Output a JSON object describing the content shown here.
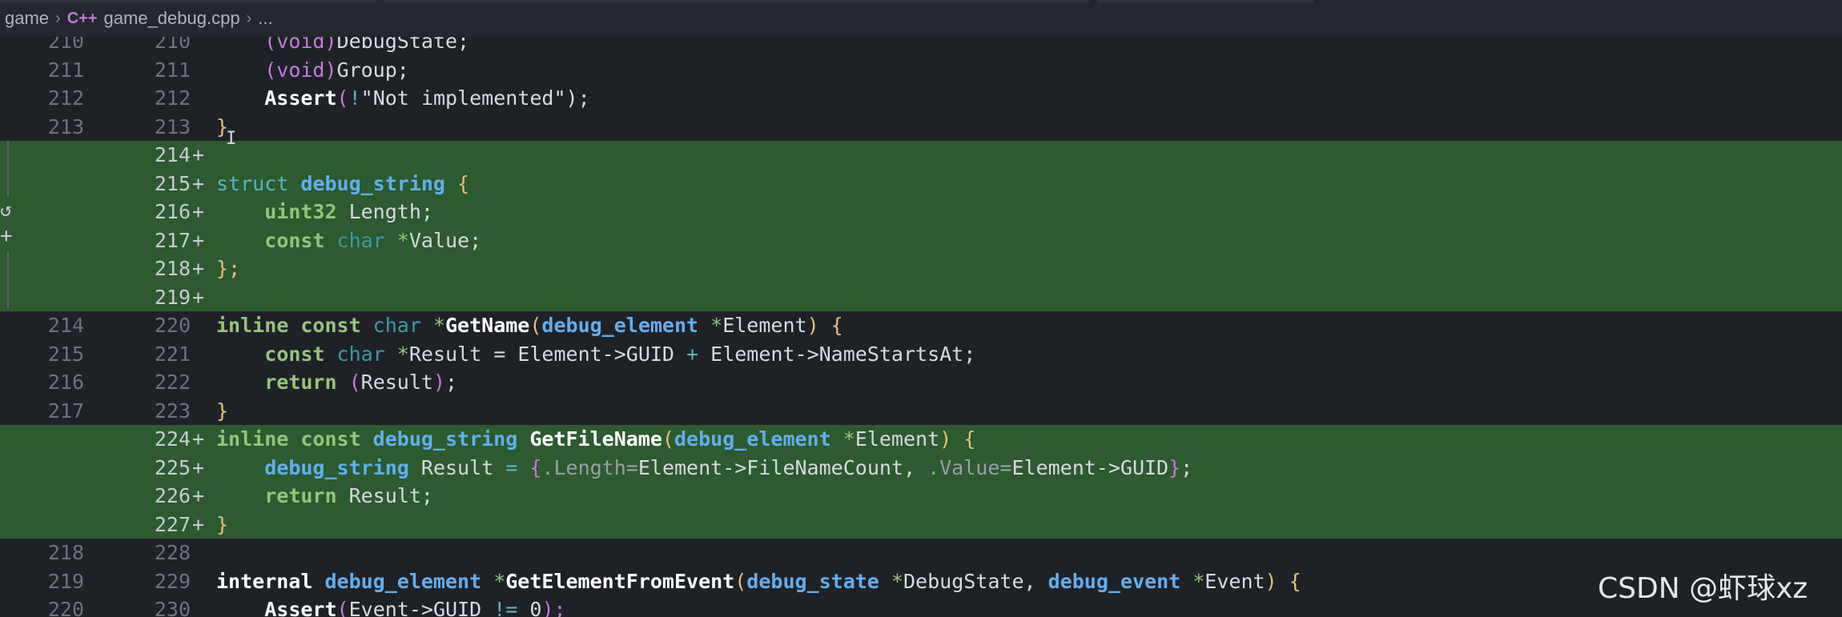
{
  "breadcrumb": {
    "folder": "game",
    "lang_icon": "C++",
    "file": "game_debug.cpp",
    "ellipsis": "..."
  },
  "watermark": "CSDN @虾球xz",
  "lines": [
    {
      "old": "210",
      "new": "210",
      "added": false,
      "tokens": [
        [
          "    ",
          "st"
        ],
        [
          "(void)",
          "pp"
        ],
        [
          "DebugState;",
          "st"
        ]
      ]
    },
    {
      "old": "211",
      "new": "211",
      "added": false,
      "tokens": [
        [
          "    ",
          "st"
        ],
        [
          "(void)",
          "pp"
        ],
        [
          "Group;",
          "st"
        ]
      ]
    },
    {
      "old": "212",
      "new": "212",
      "added": false,
      "tokens": [
        [
          "    ",
          "st"
        ],
        [
          "Assert",
          "fn"
        ],
        [
          "(",
          "pp"
        ],
        [
          "!",
          "op"
        ],
        [
          "\"Not implemented\"",
          "st"
        ],
        [
          ");",
          "st"
        ]
      ]
    },
    {
      "old": "213",
      "new": "213",
      "added": false,
      "tokens": [
        [
          "}",
          "pr"
        ]
      ]
    },
    {
      "old": "",
      "new": "214",
      "added": true,
      "tokens": []
    },
    {
      "old": "",
      "new": "215",
      "added": true,
      "tokens": [
        [
          "struct ",
          "kw"
        ],
        [
          "debug_string ",
          "ty"
        ],
        [
          "{",
          "pr"
        ]
      ]
    },
    {
      "old": "",
      "new": "216",
      "added": true,
      "tokens": [
        [
          "    ",
          "st"
        ],
        [
          "uint32 ",
          "kwb"
        ],
        [
          "Length;",
          "st"
        ]
      ]
    },
    {
      "old": "",
      "new": "217",
      "added": true,
      "tokens": [
        [
          "    ",
          "st"
        ],
        [
          "const ",
          "kwb"
        ],
        [
          "char ",
          "tyd"
        ],
        [
          "*",
          "ptr"
        ],
        [
          "Value;",
          "st"
        ]
      ]
    },
    {
      "old": "",
      "new": "218",
      "added": true,
      "tokens": [
        [
          "};",
          "pr"
        ]
      ]
    },
    {
      "old": "",
      "new": "219",
      "added": true,
      "tokens": []
    },
    {
      "old": "214",
      "new": "220",
      "added": false,
      "tokens": [
        [
          "inline ",
          "kwb"
        ],
        [
          "const ",
          "kwb"
        ],
        [
          "char ",
          "tyd"
        ],
        [
          "*",
          "ptr"
        ],
        [
          "GetName",
          "fn"
        ],
        [
          "(",
          "pr"
        ],
        [
          "debug_element ",
          "ty"
        ],
        [
          "*",
          "ptr"
        ],
        [
          "Element",
          "st"
        ],
        [
          ") {",
          "pr"
        ]
      ]
    },
    {
      "old": "215",
      "new": "221",
      "added": false,
      "tokens": [
        [
          "    ",
          "st"
        ],
        [
          "const ",
          "kwb"
        ],
        [
          "char ",
          "tyd"
        ],
        [
          "*",
          "ptr"
        ],
        [
          "Result = Element->GUID ",
          "st"
        ],
        [
          "+ ",
          "op"
        ],
        [
          "Element->NameStartsAt;",
          "st"
        ]
      ]
    },
    {
      "old": "216",
      "new": "222",
      "added": false,
      "tokens": [
        [
          "    ",
          "st"
        ],
        [
          "return ",
          "kwb"
        ],
        [
          "(",
          "pp"
        ],
        [
          "Result",
          "st"
        ],
        [
          ")",
          "pp"
        ],
        [
          ";",
          "st"
        ]
      ]
    },
    {
      "old": "217",
      "new": "223",
      "added": false,
      "tokens": [
        [
          "}",
          "pr"
        ]
      ]
    },
    {
      "old": "",
      "new": "224",
      "added": true,
      "tokens": [
        [
          "inline ",
          "kwb"
        ],
        [
          "const ",
          "kwb"
        ],
        [
          "debug_string ",
          "ty"
        ],
        [
          "GetFileName",
          "fn"
        ],
        [
          "(",
          "pr"
        ],
        [
          "debug_element ",
          "ty"
        ],
        [
          "*",
          "ptr"
        ],
        [
          "Element",
          "st"
        ],
        [
          ") {",
          "pr"
        ]
      ]
    },
    {
      "old": "",
      "new": "225",
      "added": true,
      "tokens": [
        [
          "    ",
          "st"
        ],
        [
          "debug_string ",
          "ty"
        ],
        [
          "Result ",
          "st"
        ],
        [
          "= ",
          "op"
        ],
        [
          "{",
          "pp"
        ],
        [
          ".Length=",
          "fld"
        ],
        [
          "Element->FileNameCount, ",
          "st"
        ],
        [
          ".Value=",
          "fld"
        ],
        [
          "Element->GUID",
          "st"
        ],
        [
          "}",
          "pp"
        ],
        [
          ";",
          "st"
        ]
      ]
    },
    {
      "old": "",
      "new": "226",
      "added": true,
      "tokens": [
        [
          "    ",
          "st"
        ],
        [
          "return ",
          "kwb"
        ],
        [
          "Result;",
          "st"
        ]
      ]
    },
    {
      "old": "",
      "new": "227",
      "added": true,
      "tokens": [
        [
          "}",
          "pr"
        ]
      ]
    },
    {
      "old": "218",
      "new": "228",
      "added": false,
      "tokens": []
    },
    {
      "old": "219",
      "new": "229",
      "added": false,
      "tokens": [
        [
          "internal ",
          "fn"
        ],
        [
          "debug_element ",
          "ty"
        ],
        [
          "*",
          "ptr"
        ],
        [
          "GetElementFromEvent",
          "fn"
        ],
        [
          "(",
          "pr"
        ],
        [
          "debug_state ",
          "ty"
        ],
        [
          "*",
          "ptr"
        ],
        [
          "DebugState, ",
          "st"
        ],
        [
          "debug_event ",
          "ty"
        ],
        [
          "*",
          "ptr"
        ],
        [
          "Event",
          "st"
        ],
        [
          ") {",
          "pr"
        ]
      ]
    },
    {
      "old": "220",
      "new": "230",
      "added": false,
      "tokens": [
        [
          "    ",
          "st"
        ],
        [
          "Assert",
          "fn"
        ],
        [
          "(",
          "pp"
        ],
        [
          "Event->GUID ",
          "st"
        ],
        [
          "!= ",
          "op"
        ],
        [
          "0",
          "st"
        ],
        [
          ");",
          "pp"
        ]
      ]
    }
  ]
}
